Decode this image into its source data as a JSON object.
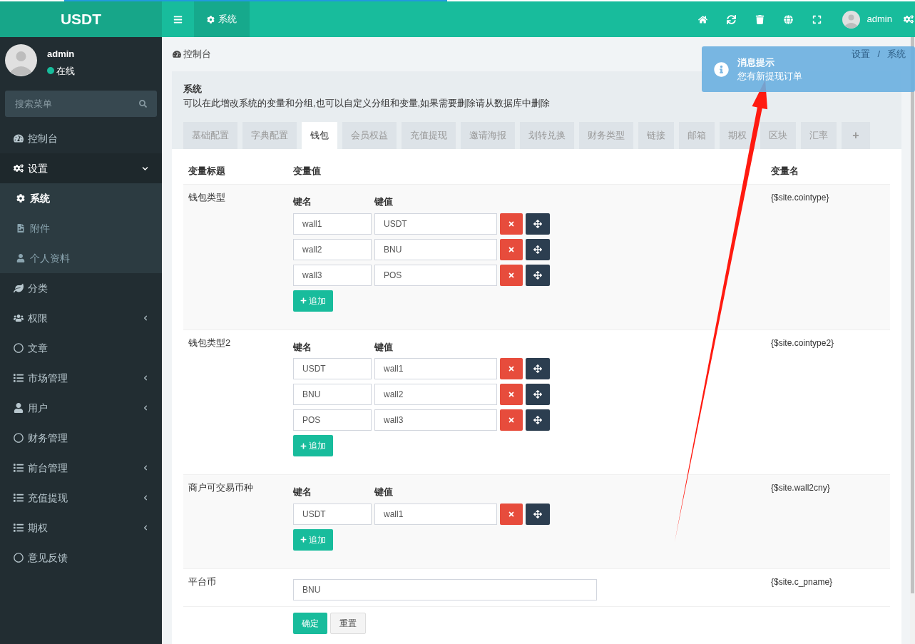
{
  "loading_bar": {
    "level": 0.45
  },
  "logo": "USDT",
  "header": {
    "tab": {
      "label": "系统",
      "selected": true
    },
    "user": "admin"
  },
  "sidebar": {
    "user": {
      "name": "admin",
      "status": "在线",
      "online": true
    },
    "search": {
      "placeholder": "搜索菜单"
    },
    "menu": [
      {
        "label": "控制台",
        "selected": false
      },
      {
        "label": "设置",
        "selected": false,
        "expanded": true,
        "children": [
          {
            "label": "系统",
            "selected": true
          },
          {
            "label": "附件",
            "selected": false
          },
          {
            "label": "个人资料",
            "selected": false
          }
        ]
      },
      {
        "label": "分类",
        "selected": false
      },
      {
        "label": "权限",
        "selected": false,
        "expanded": false
      },
      {
        "label": "文章",
        "selected": false
      },
      {
        "label": "市场管理",
        "selected": false,
        "expanded": false
      },
      {
        "label": "用户",
        "selected": false,
        "expanded": false
      },
      {
        "label": "财务管理",
        "selected": false
      },
      {
        "label": "前台管理",
        "selected": false,
        "expanded": false
      },
      {
        "label": "充值提现",
        "selected": false,
        "expanded": false
      },
      {
        "label": "期权",
        "selected": false,
        "expanded": false
      },
      {
        "label": "意见反馈",
        "selected": false
      }
    ]
  },
  "breadcrumb": {
    "title": "控制台",
    "trail": [
      "设置",
      "/",
      "系统"
    ]
  },
  "notification": {
    "title": "消息提示",
    "message": "您有新提现订单"
  },
  "panel": {
    "title": "系统",
    "description": "可以在此增改系统的变量和分组,也可以自定义分组和变量,如果需要删除请从数据库中删除",
    "tabs": [
      {
        "label": "基础配置",
        "selected": false
      },
      {
        "label": "字典配置",
        "selected": false
      },
      {
        "label": "钱包",
        "selected": true
      },
      {
        "label": "会员权益",
        "selected": false
      },
      {
        "label": "充值提现",
        "selected": false
      },
      {
        "label": "邀请海报",
        "selected": false
      },
      {
        "label": "划转兑换",
        "selected": false
      },
      {
        "label": "财务类型",
        "selected": false
      },
      {
        "label": "链接",
        "selected": false
      },
      {
        "label": "邮箱",
        "selected": false
      },
      {
        "label": "期权",
        "selected": false
      },
      {
        "label": "区块",
        "selected": false
      },
      {
        "label": "汇率",
        "selected": false
      }
    ],
    "add_tab": "+"
  },
  "table": {
    "columns": [
      "变量标题",
      "变量值",
      "变量名"
    ],
    "rows": [
      {
        "kind": "array",
        "title": "钱包类型",
        "key_header": "键名",
        "value_header": "键值",
        "pairs": [
          {
            "key": "wall1",
            "value": "USDT"
          },
          {
            "key": "wall2",
            "value": "BNU"
          },
          {
            "key": "wall3",
            "value": "POS"
          }
        ],
        "add_button": "追加",
        "variable": "{$site.cointype}"
      },
      {
        "kind": "array",
        "title": "钱包类型2",
        "key_header": "键名",
        "value_header": "键值",
        "pairs": [
          {
            "key": "USDT",
            "value": "wall1"
          },
          {
            "key": "BNU",
            "value": "wall2"
          },
          {
            "key": "POS",
            "value": "wall3"
          }
        ],
        "add_button": "追加",
        "variable": "{$site.cointype2}"
      },
      {
        "kind": "array",
        "title": "商户可交易币种",
        "key_header": "键名",
        "value_header": "键值",
        "pairs": [
          {
            "key": "USDT",
            "value": "wall1"
          }
        ],
        "add_button": "追加",
        "variable": "{$site.wall2cny}"
      },
      {
        "kind": "text",
        "title": "平台币",
        "value": "BNU",
        "variable": "{$site.c_pname}"
      }
    ]
  },
  "buttons": [
    {
      "label": "确定",
      "kind": "primary"
    },
    {
      "label": "重置",
      "kind": "default"
    }
  ]
}
